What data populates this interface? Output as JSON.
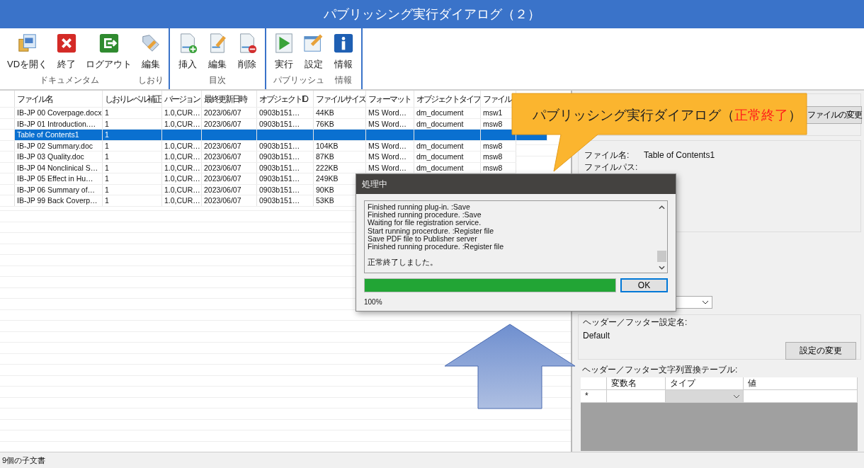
{
  "window": {
    "title": "パブリッシング実行ダイアログ（２）"
  },
  "toolbar": {
    "sections": [
      {
        "groups": [
          {
            "label": "ドキュメンタム",
            "buttons": [
              {
                "label": "VDを開く",
                "kind": "open"
              },
              {
                "label": "終了",
                "kind": "close"
              },
              {
                "label": "ログアウト",
                "kind": "logout"
              }
            ]
          },
          {
            "label": "しおり",
            "buttons": [
              {
                "label": "編集",
                "kind": "tag"
              }
            ]
          }
        ]
      },
      {
        "groups": [
          {
            "label": "目次",
            "buttons": [
              {
                "label": "挿入",
                "kind": "doc-add"
              },
              {
                "label": "編集",
                "kind": "doc-edit"
              },
              {
                "label": "削除",
                "kind": "doc-remove"
              }
            ]
          }
        ]
      },
      {
        "groups": [
          {
            "label": "パブリッシュ",
            "buttons": [
              {
                "label": "実行",
                "kind": "run"
              },
              {
                "label": "設定",
                "kind": "settings"
              }
            ]
          },
          {
            "label": "情報",
            "buttons": [
              {
                "label": "情報",
                "kind": "info"
              }
            ]
          }
        ]
      }
    ]
  },
  "table": {
    "columns": [
      "ファイル名",
      "しおりレベル補正",
      "バージョン",
      "最終更新日時",
      "オブジェクトID",
      "ファイルサイズ",
      "フォーマット",
      "オブジェクトタイプ",
      "ファイル"
    ],
    "rows": [
      {
        "selected": false,
        "cells": [
          "IB-JP 00 Coverpage.docx",
          "1",
          "1.0,CUR…",
          "2023/06/07",
          "0903b151…",
          "44KB",
          "MS Word…",
          "dm_document",
          "msw1"
        ]
      },
      {
        "selected": false,
        "cells": [
          "IB-JP 01 Introduction.…",
          "1",
          "1.0,CUR…",
          "2023/06/07",
          "0903b151…",
          "76KB",
          "MS Word…",
          "dm_document",
          "msw8"
        ]
      },
      {
        "selected": true,
        "cells": [
          "Table of Contents1",
          "1"
        ]
      },
      {
        "selected": false,
        "cells": [
          "IB-JP 02 Summary.doc",
          "1",
          "1.0,CUR…",
          "2023/06/07",
          "0903b151…",
          "104KB",
          "MS Word…",
          "dm_document",
          "msw8"
        ]
      },
      {
        "selected": false,
        "cells": [
          "IB-JP 03 Quality.doc",
          "1",
          "1.0,CUR…",
          "2023/06/07",
          "0903b151…",
          "87KB",
          "MS Word…",
          "dm_document",
          "msw8"
        ]
      },
      {
        "selected": false,
        "cells": [
          "IB-JP 04 Nonclinical S…",
          "1",
          "1.0,CUR…",
          "2023/06/07",
          "0903b151…",
          "222KB",
          "MS Word…",
          "dm_document",
          "msw8"
        ]
      },
      {
        "selected": false,
        "cells": [
          "IB-JP 05 Effect in Hu…",
          "1",
          "1.0,CUR…",
          "2023/06/07",
          "0903b151…",
          "249KB"
        ]
      },
      {
        "selected": false,
        "cells": [
          "IB-JP 06 Summary of…",
          "1",
          "1.0,CUR…",
          "2023/06/07",
          "0903b151…",
          "90KB"
        ]
      },
      {
        "selected": false,
        "cells": [
          "IB-JP 99 Back Coverp…",
          "1",
          "1.0,CUR…",
          "2023/06/07",
          "0903b151…",
          "53KB"
        ]
      }
    ]
  },
  "properties": {
    "change_file_button": "ファイルの変更",
    "fields": [
      {
        "label": "ファイル名:",
        "value": "Table of Contents1"
      },
      {
        "label": "ファイルパス:"
      }
    ],
    "header_footer": {
      "label": "ヘッダー／フッター設定名:",
      "value": "Default",
      "button": "設定の変更"
    },
    "replace_table": {
      "label": "ヘッダー／フッター文字列置換テーブル:",
      "columns": [
        "変数名",
        "タイプ",
        "値"
      ],
      "new_row_marker": "*"
    }
  },
  "status_bar": "9個の子文書",
  "callout": {
    "text": "パブリッシング実行ダイアログ（",
    "highlight": "正常終了",
    "text_end": "）"
  },
  "dialog": {
    "title": "処理中",
    "log": [
      "Finished running plug-in. :Save",
      "Finished running procedure. :Save",
      "Waiting for file registration service.",
      "Start running procerdure. :Register file",
      "Save PDF file to Publisher server",
      "Finished running procedure. :Register file"
    ],
    "message": "正常終了しました。",
    "progress": {
      "level": 1,
      "reading": "100%"
    },
    "ok_button": "OK"
  }
}
